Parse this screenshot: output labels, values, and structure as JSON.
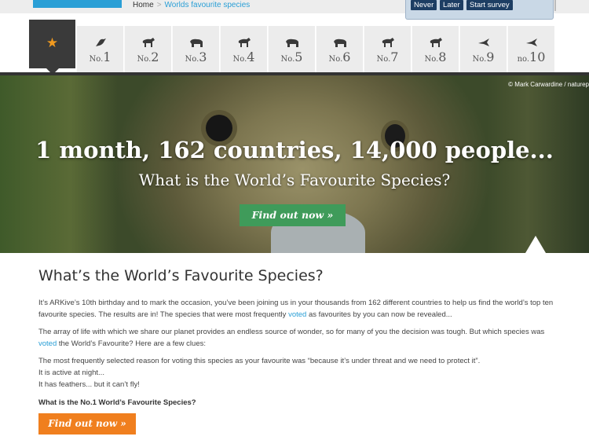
{
  "breadcrumb": {
    "home": "Home",
    "separator": ">",
    "current": "Worlds favourite species"
  },
  "survey": {
    "never": "Never",
    "later": "Later",
    "start": "Start survey"
  },
  "nav": {
    "tabs": [
      {
        "icon": "star-icon"
      },
      {
        "prefix": "No.",
        "num": "1",
        "icon": "bird-icon"
      },
      {
        "prefix": "No.",
        "num": "2",
        "icon": "big-cat-icon"
      },
      {
        "prefix": "No.",
        "num": "3",
        "icon": "elephant-icon"
      },
      {
        "prefix": "No.",
        "num": "4",
        "icon": "wild-dog-icon"
      },
      {
        "prefix": "No.",
        "num": "5",
        "icon": "bear-icon"
      },
      {
        "prefix": "No.",
        "num": "6",
        "icon": "turtle-icon"
      },
      {
        "prefix": "No.",
        "num": "7",
        "icon": "ape-icon"
      },
      {
        "prefix": "No.",
        "num": "8",
        "icon": "dinosaur-icon"
      },
      {
        "prefix": "No.",
        "num": "9",
        "icon": "hummingbird-icon"
      },
      {
        "prefix": "no.",
        "num": "10",
        "icon": "lizard-icon"
      }
    ]
  },
  "hero": {
    "credit": "© Mark Carwardine / naturep",
    "headline": "1 month, 162 countries, 14,000 people...",
    "subheadline": "What is the World’s Favourite Species?",
    "button": "Find out now »"
  },
  "content": {
    "title": "What’s the World’s Favourite Species?",
    "p1_a": "It’s ARKive’s 10th birthday and to mark the occasion, you’ve been joining us in your thousands from 162 different countries to help us find the world’s top ten favourite species. The results are in! The species that were most frequently ",
    "p1_link": "voted",
    "p1_b": " as favourites by you can now be revealed...",
    "p2_a": "The array of life with which we share our planet provides an endless source of wonder, so for many of you the decision was tough. But which species was ",
    "p2_link": "voted",
    "p2_b": " the World’s Favourite? Here are a few clues:",
    "clue1": "The most frequently selected reason for voting this species as your favourite was “because it’s under threat and we need to protect it”.",
    "clue2": "It is active at night...",
    "clue3": "It has feathers... but it can’t fly!",
    "question": "What is the No.1 World’s Favourite Species?",
    "button": "Find out now »"
  },
  "colors": {
    "accent_blue": "#2a9fd6",
    "hero_button": "#3f9b5a",
    "cta_orange": "#f07f1e",
    "star": "#f19a1f"
  }
}
